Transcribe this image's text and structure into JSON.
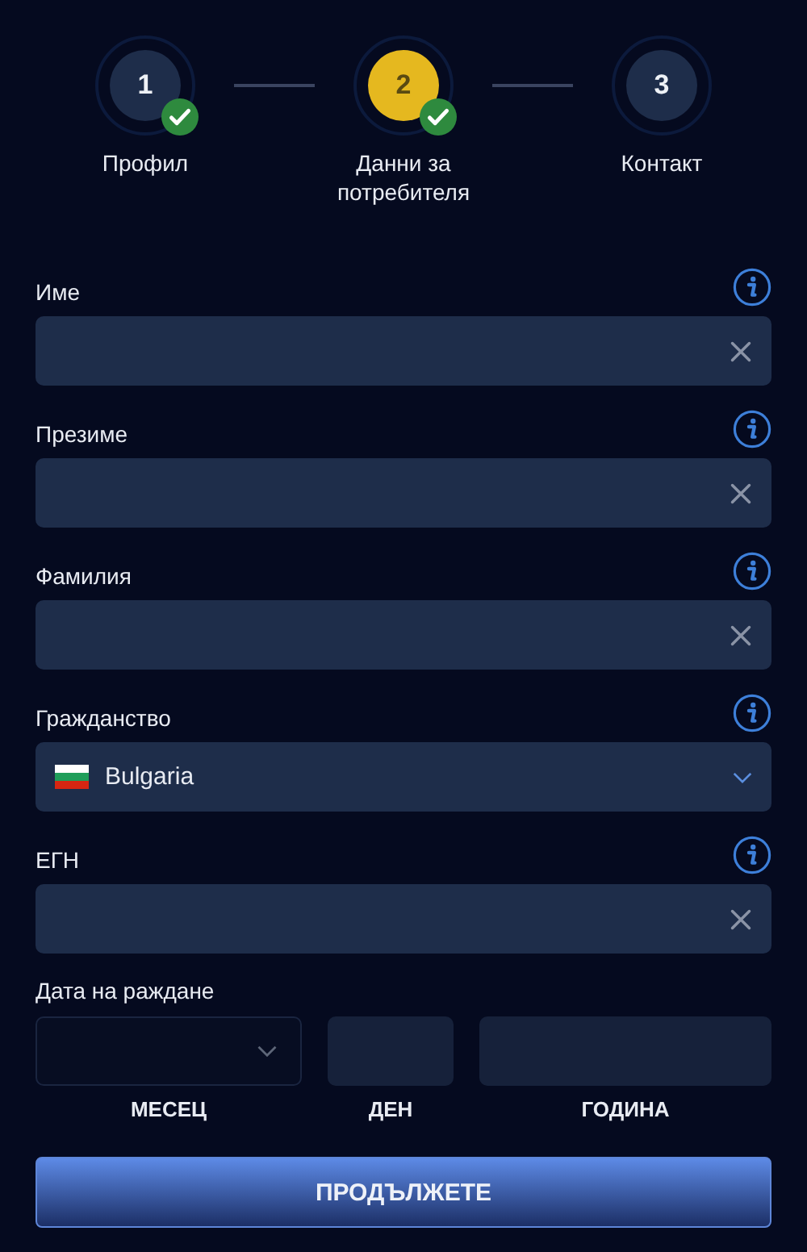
{
  "steps": [
    {
      "number": "1",
      "label": "Профил",
      "done": true,
      "active": false
    },
    {
      "number": "2",
      "label": "Данни за потребителя",
      "done": true,
      "active": true
    },
    {
      "number": "3",
      "label": "Контакт",
      "done": false,
      "active": false
    }
  ],
  "fields": [
    {
      "kind": "text",
      "label": "Име"
    },
    {
      "kind": "text",
      "label": "Презиме"
    },
    {
      "kind": "text",
      "label": "Фамилия"
    },
    {
      "kind": "select",
      "label": "Гражданство",
      "value": "Bulgaria"
    },
    {
      "kind": "text",
      "label": "ЕГН"
    }
  ],
  "birth_date": {
    "label": "Дата на раждане",
    "parts": [
      {
        "kind": "select",
        "caption": "МЕСЕЦ"
      },
      {
        "kind": "text",
        "caption": "ДЕН"
      },
      {
        "kind": "text",
        "caption": "ГОДИНА"
      }
    ]
  },
  "submit": {
    "label": "ПРОДЪЛЖЕТЕ"
  }
}
